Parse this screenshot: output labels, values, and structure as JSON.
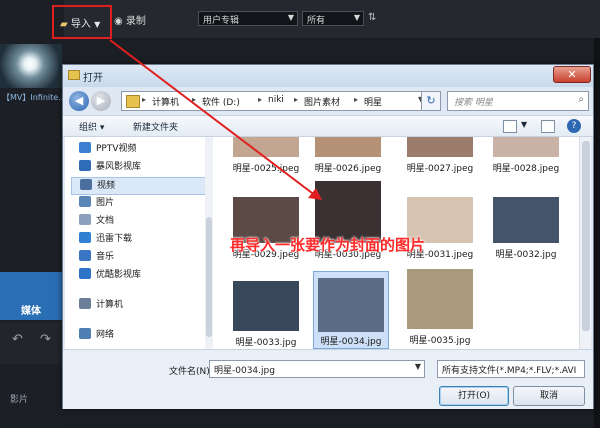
{
  "app": {
    "toolbar": {
      "import_label": "导入",
      "record_label": "录制",
      "category_value": "用户专辑",
      "filter_value": "所有"
    },
    "media_label": "【MV】Infinite...",
    "media_tab": "媒体",
    "track_label": "影片"
  },
  "dialog": {
    "title": "打开",
    "close_symbol": "✕",
    "breadcrumbs": [
      "计算机",
      "软件 (D:)",
      "niki",
      "图片素材",
      "明星"
    ],
    "search_placeholder": "搜索 明星",
    "toolbar": {
      "organize": "组织 ▾",
      "new_folder": "新建文件夹"
    },
    "nav_items": [
      {
        "label": "PPTV视频",
        "color": "#3a7fd0",
        "selected": false
      },
      {
        "label": "暴风影视库",
        "color": "#2f6bb8",
        "selected": false
      },
      {
        "label": "视频",
        "color": "#4a6f9c",
        "selected": true
      },
      {
        "label": "图片",
        "color": "#5b86b8",
        "selected": false
      },
      {
        "label": "文档",
        "color": "#8aa0bb",
        "selected": false
      },
      {
        "label": "迅雷下载",
        "color": "#2f82d3",
        "selected": false
      },
      {
        "label": "音乐",
        "color": "#3b76c4",
        "selected": false
      },
      {
        "label": "优酷影视库",
        "color": "#2d73c6",
        "selected": false
      },
      {
        "label": "计算机",
        "color": "#6b7f98",
        "selected": false
      },
      {
        "label": "网络",
        "color": "#4f7eb4",
        "selected": false
      }
    ],
    "files": [
      {
        "name": "明星-0025.jpeg",
        "tone": "#c2a691"
      },
      {
        "name": "明星-0026.jpeg",
        "tone": "#b59276"
      },
      {
        "name": "明星-0027.jpeg",
        "tone": "#9c7d6b"
      },
      {
        "name": "明星-0028.jpeg",
        "tone": "#c9b3a7"
      },
      {
        "name": "明星-0029.jpeg",
        "tone": "#5b4a45"
      },
      {
        "name": "明星-0030.jpeg",
        "tone": "#3b3133"
      },
      {
        "name": "明星-0031.jpeg",
        "tone": "#d7c3b2"
      },
      {
        "name": "明星-0032.jpg",
        "tone": "#44546a"
      },
      {
        "name": "明星-0033.jpg",
        "tone": "#39475a"
      },
      {
        "name": "明星-0034.jpg",
        "tone": "#5a6c86"
      },
      {
        "name": "明星-0035.jpg",
        "tone": "#a99a7e"
      }
    ],
    "filename_label": "文件名(N):",
    "filename_value": "明星-0034.jpg",
    "filetype_value": "所有支持文件(*.MP4;*.FLV;*.AVI",
    "open_button": "打开(O)",
    "cancel_button": "取消"
  },
  "annotation_text": "再导入一张要作为封面的图片",
  "colors": {
    "highlight_red": "#e02020",
    "accent_blue": "#2a6fb6"
  }
}
